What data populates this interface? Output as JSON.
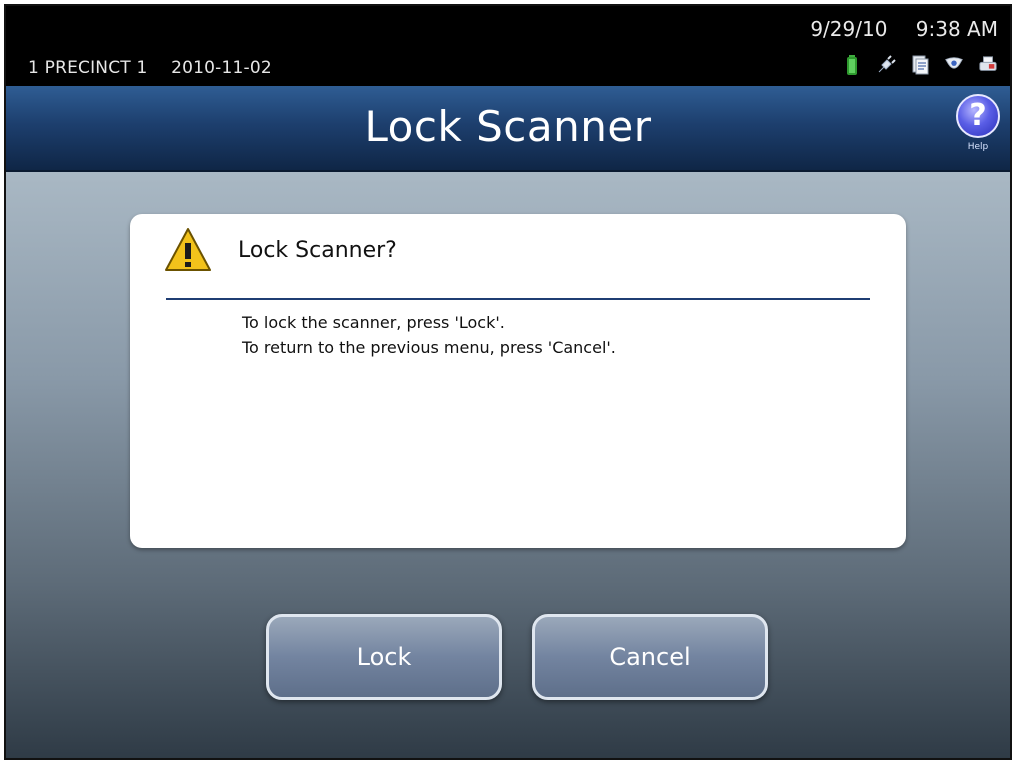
{
  "status": {
    "precinct": "1 PRECINCT 1",
    "election_date": "2010-11-02",
    "date": "9/29/10",
    "time": "9:38 AM",
    "icons": [
      "battery-icon",
      "power-plug-icon",
      "document-icon",
      "shield-icon",
      "printer-icon"
    ]
  },
  "header": {
    "title": "Lock Scanner",
    "help_label": "Help",
    "help_glyph": "?"
  },
  "dialog": {
    "icon": "warning-icon",
    "title": "Lock Scanner?",
    "lines": [
      "To lock the scanner, press 'Lock'.",
      "To return to the previous menu, press 'Cancel'."
    ]
  },
  "buttons": {
    "lock_label": "Lock",
    "cancel_label": "Cancel"
  },
  "colors": {
    "titlebar": "#1d3f6e",
    "button": "#7384a0",
    "rule": "#1f3d73",
    "warning": "#f2c21b"
  }
}
